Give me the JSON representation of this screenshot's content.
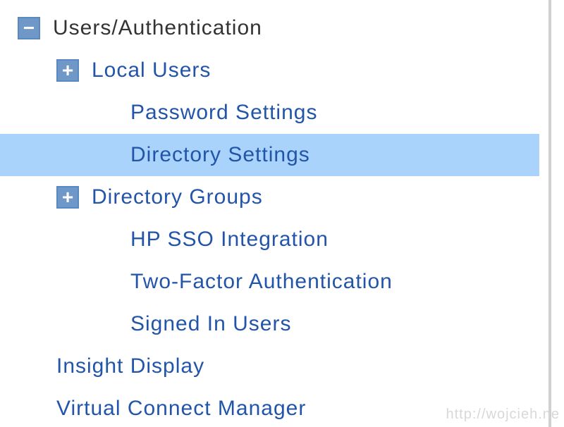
{
  "tree": {
    "root": {
      "label": "Users/Authentication",
      "toggle": "−",
      "children": {
        "local_users": {
          "label": "Local Users",
          "toggle": "+"
        },
        "password_settings": {
          "label": "Password Settings"
        },
        "directory_settings": {
          "label": "Directory Settings",
          "selected": true
        },
        "directory_groups": {
          "label": "Directory Groups",
          "toggle": "+"
        },
        "hp_sso": {
          "label": "HP SSO Integration"
        },
        "two_factor": {
          "label": "Two-Factor Authentication"
        },
        "signed_in": {
          "label": "Signed In Users"
        }
      }
    },
    "insight_display": {
      "label": "Insight Display"
    },
    "virtual_connect_manager": {
      "label": "Virtual Connect Manager"
    }
  },
  "watermark": "http://wojcieh.ne"
}
